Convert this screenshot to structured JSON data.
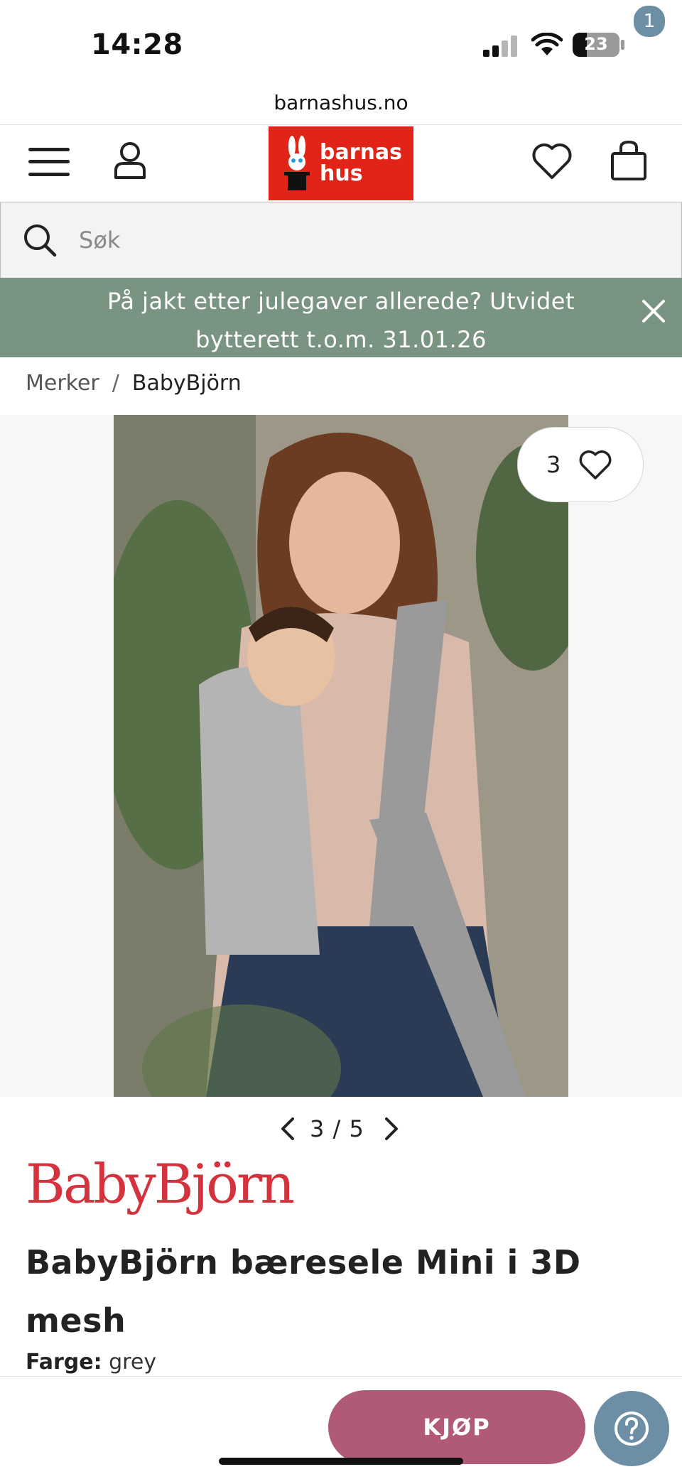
{
  "status_bar": {
    "time": "14:28",
    "battery": "23"
  },
  "browser": {
    "url": "barnashus.no"
  },
  "header": {
    "logo_line1": "barnas",
    "logo_line2": "hus",
    "cart_count": "1"
  },
  "search": {
    "placeholder": "Søk"
  },
  "promo": {
    "text": "På jakt etter julegaver allerede? Utvidet bytterett t.o.m. 31.01.26"
  },
  "breadcrumb": {
    "items": [
      "Merker",
      "BabyBjörn"
    ],
    "separator": "/"
  },
  "gallery": {
    "favorite_count": "3",
    "pager": "3 / 5"
  },
  "product": {
    "brand": "BabyBjörn",
    "title": "BabyBjörn bæresele Mini i 3D mesh",
    "color_label": "Farge:",
    "color_value": "grey"
  },
  "actions": {
    "buy_label": "KJØP"
  },
  "colors": {
    "logo_red": "#e02518",
    "promo_green": "#7a9482",
    "brand_red": "#d4333e",
    "buy_pink": "#b05a78",
    "accent_blue": "#6d8fa6"
  },
  "icons": [
    "menu-icon",
    "account-icon",
    "heart-icon",
    "cart-icon",
    "search-icon",
    "close-icon",
    "chevron-left-icon",
    "chevron-right-icon",
    "help-icon",
    "signal-icon",
    "wifi-icon",
    "battery-icon"
  ]
}
